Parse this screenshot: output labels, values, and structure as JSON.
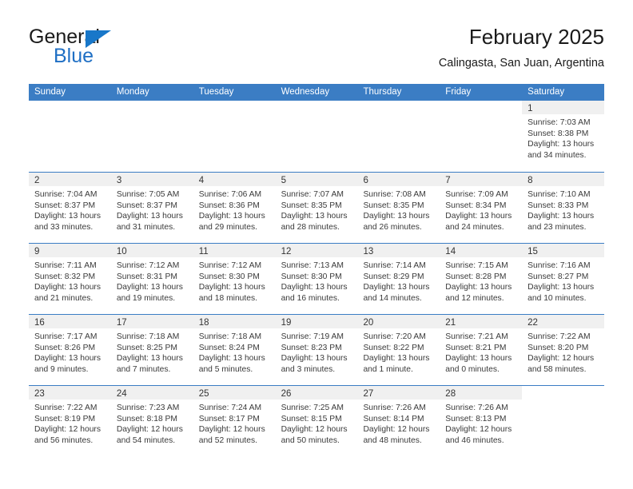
{
  "brand": {
    "word_general": "General",
    "word_blue": "Blue",
    "triangle_color": "#1877c9"
  },
  "header": {
    "title": "February 2025",
    "subtitle": "Calingasta, San Juan, Argentina"
  },
  "theme": {
    "header_blue": "#3b7dc4",
    "daystrip_gray": "#f0f0f0",
    "text": "#333333"
  },
  "calendar": {
    "weekday_headers": [
      "Sunday",
      "Monday",
      "Tuesday",
      "Wednesday",
      "Thursday",
      "Friday",
      "Saturday"
    ],
    "weeks": [
      [
        {
          "day": "",
          "lines": []
        },
        {
          "day": "",
          "lines": []
        },
        {
          "day": "",
          "lines": []
        },
        {
          "day": "",
          "lines": []
        },
        {
          "day": "",
          "lines": []
        },
        {
          "day": "",
          "lines": []
        },
        {
          "day": "1",
          "lines": [
            "Sunrise: 7:03 AM",
            "Sunset: 8:38 PM",
            "Daylight: 13 hours",
            "and 34 minutes."
          ]
        }
      ],
      [
        {
          "day": "2",
          "lines": [
            "Sunrise: 7:04 AM",
            "Sunset: 8:37 PM",
            "Daylight: 13 hours",
            "and 33 minutes."
          ]
        },
        {
          "day": "3",
          "lines": [
            "Sunrise: 7:05 AM",
            "Sunset: 8:37 PM",
            "Daylight: 13 hours",
            "and 31 minutes."
          ]
        },
        {
          "day": "4",
          "lines": [
            "Sunrise: 7:06 AM",
            "Sunset: 8:36 PM",
            "Daylight: 13 hours",
            "and 29 minutes."
          ]
        },
        {
          "day": "5",
          "lines": [
            "Sunrise: 7:07 AM",
            "Sunset: 8:35 PM",
            "Daylight: 13 hours",
            "and 28 minutes."
          ]
        },
        {
          "day": "6",
          "lines": [
            "Sunrise: 7:08 AM",
            "Sunset: 8:35 PM",
            "Daylight: 13 hours",
            "and 26 minutes."
          ]
        },
        {
          "day": "7",
          "lines": [
            "Sunrise: 7:09 AM",
            "Sunset: 8:34 PM",
            "Daylight: 13 hours",
            "and 24 minutes."
          ]
        },
        {
          "day": "8",
          "lines": [
            "Sunrise: 7:10 AM",
            "Sunset: 8:33 PM",
            "Daylight: 13 hours",
            "and 23 minutes."
          ]
        }
      ],
      [
        {
          "day": "9",
          "lines": [
            "Sunrise: 7:11 AM",
            "Sunset: 8:32 PM",
            "Daylight: 13 hours",
            "and 21 minutes."
          ]
        },
        {
          "day": "10",
          "lines": [
            "Sunrise: 7:12 AM",
            "Sunset: 8:31 PM",
            "Daylight: 13 hours",
            "and 19 minutes."
          ]
        },
        {
          "day": "11",
          "lines": [
            "Sunrise: 7:12 AM",
            "Sunset: 8:30 PM",
            "Daylight: 13 hours",
            "and 18 minutes."
          ]
        },
        {
          "day": "12",
          "lines": [
            "Sunrise: 7:13 AM",
            "Sunset: 8:30 PM",
            "Daylight: 13 hours",
            "and 16 minutes."
          ]
        },
        {
          "day": "13",
          "lines": [
            "Sunrise: 7:14 AM",
            "Sunset: 8:29 PM",
            "Daylight: 13 hours",
            "and 14 minutes."
          ]
        },
        {
          "day": "14",
          "lines": [
            "Sunrise: 7:15 AM",
            "Sunset: 8:28 PM",
            "Daylight: 13 hours",
            "and 12 minutes."
          ]
        },
        {
          "day": "15",
          "lines": [
            "Sunrise: 7:16 AM",
            "Sunset: 8:27 PM",
            "Daylight: 13 hours",
            "and 10 minutes."
          ]
        }
      ],
      [
        {
          "day": "16",
          "lines": [
            "Sunrise: 7:17 AM",
            "Sunset: 8:26 PM",
            "Daylight: 13 hours",
            "and 9 minutes."
          ]
        },
        {
          "day": "17",
          "lines": [
            "Sunrise: 7:18 AM",
            "Sunset: 8:25 PM",
            "Daylight: 13 hours",
            "and 7 minutes."
          ]
        },
        {
          "day": "18",
          "lines": [
            "Sunrise: 7:18 AM",
            "Sunset: 8:24 PM",
            "Daylight: 13 hours",
            "and 5 minutes."
          ]
        },
        {
          "day": "19",
          "lines": [
            "Sunrise: 7:19 AM",
            "Sunset: 8:23 PM",
            "Daylight: 13 hours",
            "and 3 minutes."
          ]
        },
        {
          "day": "20",
          "lines": [
            "Sunrise: 7:20 AM",
            "Sunset: 8:22 PM",
            "Daylight: 13 hours",
            "and 1 minute."
          ]
        },
        {
          "day": "21",
          "lines": [
            "Sunrise: 7:21 AM",
            "Sunset: 8:21 PM",
            "Daylight: 13 hours",
            "and 0 minutes."
          ]
        },
        {
          "day": "22",
          "lines": [
            "Sunrise: 7:22 AM",
            "Sunset: 8:20 PM",
            "Daylight: 12 hours",
            "and 58 minutes."
          ]
        }
      ],
      [
        {
          "day": "23",
          "lines": [
            "Sunrise: 7:22 AM",
            "Sunset: 8:19 PM",
            "Daylight: 12 hours",
            "and 56 minutes."
          ]
        },
        {
          "day": "24",
          "lines": [
            "Sunrise: 7:23 AM",
            "Sunset: 8:18 PM",
            "Daylight: 12 hours",
            "and 54 minutes."
          ]
        },
        {
          "day": "25",
          "lines": [
            "Sunrise: 7:24 AM",
            "Sunset: 8:17 PM",
            "Daylight: 12 hours",
            "and 52 minutes."
          ]
        },
        {
          "day": "26",
          "lines": [
            "Sunrise: 7:25 AM",
            "Sunset: 8:15 PM",
            "Daylight: 12 hours",
            "and 50 minutes."
          ]
        },
        {
          "day": "27",
          "lines": [
            "Sunrise: 7:26 AM",
            "Sunset: 8:14 PM",
            "Daylight: 12 hours",
            "and 48 minutes."
          ]
        },
        {
          "day": "28",
          "lines": [
            "Sunrise: 7:26 AM",
            "Sunset: 8:13 PM",
            "Daylight: 12 hours",
            "and 46 minutes."
          ]
        },
        {
          "day": "",
          "lines": []
        }
      ]
    ]
  }
}
